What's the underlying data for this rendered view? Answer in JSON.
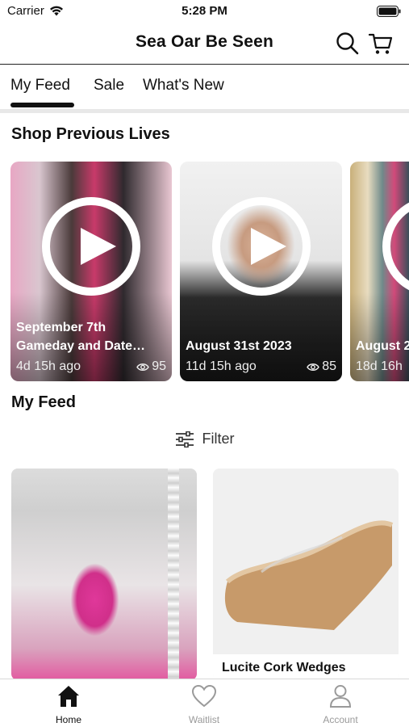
{
  "status_bar": {
    "carrier": "Carrier",
    "time": "5:28 PM"
  },
  "header": {
    "title": "Sea Oar Be Seen"
  },
  "tabs": [
    {
      "label": "My Feed",
      "active": true
    },
    {
      "label": "Sale",
      "active": false
    },
    {
      "label": "What's New",
      "active": false
    }
  ],
  "previous_lives": {
    "title": "Shop Previous Lives",
    "items": [
      {
        "title_line1": "September 7th",
        "title_line2": "Gameday and Date…",
        "age": "4d 15h ago",
        "views": "95"
      },
      {
        "title_line1": "August 31st 2023",
        "age": "11d 15h ago",
        "views": "85"
      },
      {
        "title_line1": "August 2",
        "age": "18d 16h"
      }
    ]
  },
  "feed": {
    "title": "My Feed",
    "filter_label": "Filter",
    "products": [
      {
        "name": ""
      },
      {
        "name": "Lucite Cork Wedges"
      }
    ]
  },
  "bottom_tabs": [
    {
      "label": "Home",
      "active": true
    },
    {
      "label": "Waitlist",
      "active": false
    },
    {
      "label": "Account",
      "active": false
    }
  ],
  "colors": {
    "accent": "#111111",
    "inactive": "#9a9a9a"
  }
}
